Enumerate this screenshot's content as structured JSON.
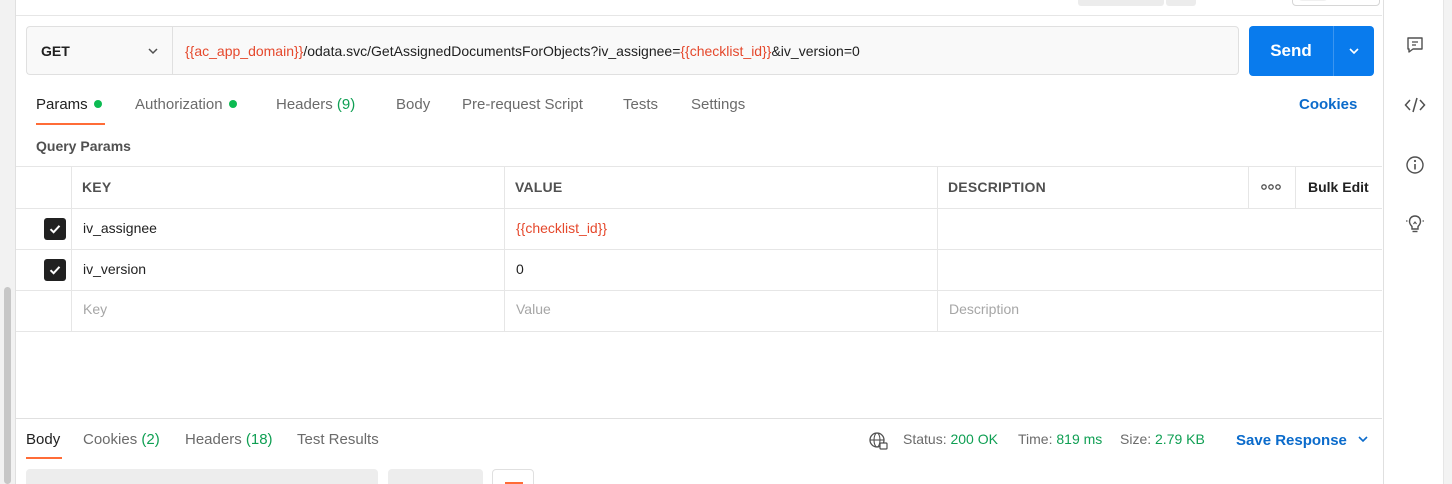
{
  "request": {
    "method": "GET",
    "url_parts": [
      {
        "text": "{{ac_app_domain}}",
        "var": true
      },
      {
        "text": "/odata.svc/GetAssignedDocumentsForObjects?iv_assignee=",
        "var": false
      },
      {
        "text": "{{checklist_id}}",
        "var": true
      },
      {
        "text": "&iv_version=0",
        "var": false
      }
    ],
    "send_label": "Send"
  },
  "tabs": {
    "params": "Params",
    "authorization": "Authorization",
    "headers": "Headers",
    "headers_count": "(9)",
    "body": "Body",
    "prerequest": "Pre-request Script",
    "tests": "Tests",
    "settings": "Settings",
    "cookies": "Cookies"
  },
  "query_params": {
    "title": "Query Params",
    "columns": {
      "key": "KEY",
      "value": "VALUE",
      "description": "DESCRIPTION"
    },
    "bulk_edit": "Bulk Edit",
    "rows": [
      {
        "key": "iv_assignee",
        "value": "{{checklist_id}}",
        "value_is_var": true,
        "checked": true
      },
      {
        "key": "iv_version",
        "value": "0",
        "value_is_var": false,
        "checked": true
      }
    ],
    "placeholders": {
      "key": "Key",
      "value": "Value",
      "description": "Description"
    }
  },
  "response": {
    "tabs": {
      "body": "Body",
      "cookies": "Cookies",
      "cookies_count": "(2)",
      "headers": "Headers",
      "headers_count": "(18)",
      "test_results": "Test Results"
    },
    "status_label": "Status:",
    "status_value": "200 OK",
    "time_label": "Time:",
    "time_value": "819 ms",
    "size_label": "Size:",
    "size_value": "2.79 KB",
    "save_response": "Save Response"
  },
  "colors": {
    "accent_orange": "#ff6c37",
    "send_blue": "#097bed",
    "link_blue": "#0b6bcb",
    "variable_red": "#e5482c",
    "status_green": "#0f9f53"
  },
  "icons": {
    "sidebar": [
      "comment-icon",
      "code-icon",
      "info-icon",
      "lightbulb-icon"
    ],
    "status": "globe-icon",
    "more": "more-dots-icon"
  }
}
